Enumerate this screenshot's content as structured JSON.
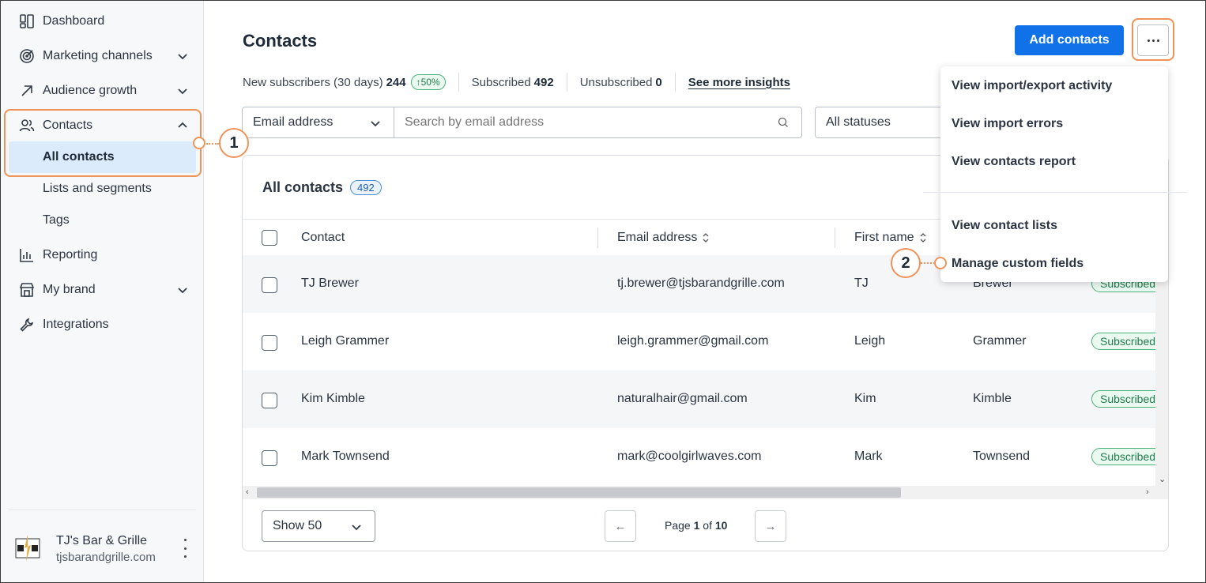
{
  "sidebar": {
    "items": [
      {
        "label": "Dashboard",
        "icon": "dashboard-icon"
      },
      {
        "label": "Marketing channels",
        "icon": "target-icon"
      },
      {
        "label": "Audience growth",
        "icon": "arrow-up-right-icon"
      },
      {
        "label": "Contacts",
        "icon": "people-icon"
      },
      {
        "label": "Reporting",
        "icon": "chart-icon"
      },
      {
        "label": "My brand",
        "icon": "store-icon"
      },
      {
        "label": "Integrations",
        "icon": "wrench-icon"
      }
    ],
    "contacts_sub": [
      "All contacts",
      "Lists and segments",
      "Tags"
    ],
    "brand": {
      "name": "TJ's Bar & Grille",
      "url": "tjsbarandgrille.com"
    }
  },
  "header": {
    "title": "Contacts",
    "add_label": "Add contacts"
  },
  "stats": {
    "new_label": "New subscribers (30 days)",
    "new_value": "244",
    "trend": "↑50%",
    "subscribed_label": "Subscribed",
    "subscribed_value": "492",
    "unsubscribed_label": "Unsubscribed",
    "unsubscribed_value": "0",
    "insights_label": "See more insights"
  },
  "filters": {
    "field": "Email address",
    "search_placeholder": "Search by email address",
    "status": "All statuses"
  },
  "table": {
    "title": "All contacts",
    "count": "492",
    "columns": [
      "Contact",
      "Email address",
      "First name"
    ],
    "rows": [
      {
        "contact": "TJ Brewer",
        "email": "tj.brewer@tjsbarandgrille.com",
        "first": "TJ",
        "last": "Brewer",
        "status": "Subscribed"
      },
      {
        "contact": "Leigh Grammer",
        "email": "leigh.grammer@gmail.com",
        "first": "Leigh",
        "last": "Grammer",
        "status": "Subscribed"
      },
      {
        "contact": "Kim Kimble",
        "email": "naturalhair@gmail.com",
        "first": "Kim",
        "last": "Kimble",
        "status": "Subscribed"
      },
      {
        "contact": "Mark Townsend",
        "email": "mark@coolgirlwaves.com",
        "first": "Mark",
        "last": "Townsend",
        "status": "Subscribed"
      }
    ]
  },
  "pagination": {
    "show": "Show 50",
    "page_prefix": "Page",
    "page_current": "1",
    "page_of": "of",
    "page_total": "10"
  },
  "menu": {
    "items": [
      "View import/export activity",
      "View import errors",
      "View contacts report",
      "View contact lists",
      "Manage custom fields"
    ]
  },
  "callouts": [
    "1",
    "2"
  ],
  "colors": {
    "accent": "#1171e8",
    "highlight": "#f0935a",
    "active_bg": "#dcebfb",
    "success": "#4cb07a"
  }
}
